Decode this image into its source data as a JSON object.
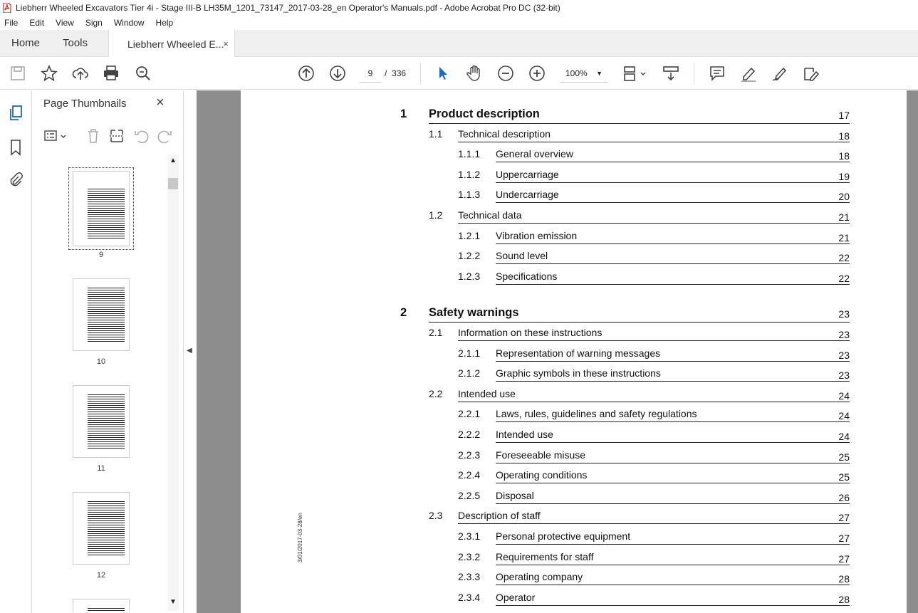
{
  "window": {
    "title": "Liebherr Wheeled Excavators Tier 4i - Stage III-B LH35M_1201_73147_2017-03-28_en Operator's Manuals.pdf - Adobe Acrobat Pro DC (32-bit)"
  },
  "menu": [
    "File",
    "Edit",
    "View",
    "Sign",
    "Window",
    "Help"
  ],
  "tabs": {
    "home": "Home",
    "tools": "Tools",
    "doc": "Liebherr Wheeled E...",
    "close": "×"
  },
  "toolbar": {
    "page_current": "9",
    "page_sep": "/",
    "page_total": "336",
    "zoom": "100%"
  },
  "panel": {
    "title": "Page Thumbnails",
    "close": "×"
  },
  "thumbnails": [
    "9",
    "10",
    "11",
    "12"
  ],
  "page": {
    "side_text": "3/01/2017-03-28/en"
  },
  "toc": [
    {
      "num": "1",
      "title": "Product description",
      "page": "17",
      "level": 0
    },
    {
      "num": "1.1",
      "title": "Technical description",
      "page": "18",
      "level": 1
    },
    {
      "num": "1.1.1",
      "title": "General overview",
      "page": "18",
      "level": 2
    },
    {
      "num": "1.1.2",
      "title": "Uppercarriage",
      "page": "19",
      "level": 2
    },
    {
      "num": "1.1.3",
      "title": "Undercarriage",
      "page": "20",
      "level": 2
    },
    {
      "num": "1.2",
      "title": "Technical data",
      "page": "21",
      "level": 1
    },
    {
      "num": "1.2.1",
      "title": "Vibration emission",
      "page": "21",
      "level": 2
    },
    {
      "num": "1.2.2",
      "title": "Sound level",
      "page": "22",
      "level": 2
    },
    {
      "num": "1.2.3",
      "title": "Specifications",
      "page": "22",
      "level": 2
    },
    {
      "num": "2",
      "title": "Safety warnings",
      "page": "23",
      "level": 0
    },
    {
      "num": "2.1",
      "title": "Information on these instructions",
      "page": "23",
      "level": 1
    },
    {
      "num": "2.1.1",
      "title": "Representation of warning messages",
      "page": "23",
      "level": 2
    },
    {
      "num": "2.1.2",
      "title": "Graphic symbols in these instructions",
      "page": "23",
      "level": 2
    },
    {
      "num": "2.2",
      "title": "Intended use",
      "page": "24",
      "level": 1
    },
    {
      "num": "2.2.1",
      "title": "Laws, rules, guidelines and safety regulations",
      "page": "24",
      "level": 2
    },
    {
      "num": "2.2.2",
      "title": "Intended use",
      "page": "24",
      "level": 2
    },
    {
      "num": "2.2.3",
      "title": "Foreseeable misuse",
      "page": "25",
      "level": 2
    },
    {
      "num": "2.2.4",
      "title": "Operating conditions",
      "page": "25",
      "level": 2
    },
    {
      "num": "2.2.5",
      "title": "Disposal",
      "page": "26",
      "level": 2
    },
    {
      "num": "2.3",
      "title": "Description of staff",
      "page": "27",
      "level": 1
    },
    {
      "num": "2.3.1",
      "title": "Personal protective equipment",
      "page": "27",
      "level": 2
    },
    {
      "num": "2.3.2",
      "title": "Requirements for staff",
      "page": "27",
      "level": 2
    },
    {
      "num": "2.3.3",
      "title": "Operating company",
      "page": "28",
      "level": 2
    },
    {
      "num": "2.3.4",
      "title": "Operator",
      "page": "28",
      "level": 2
    }
  ]
}
